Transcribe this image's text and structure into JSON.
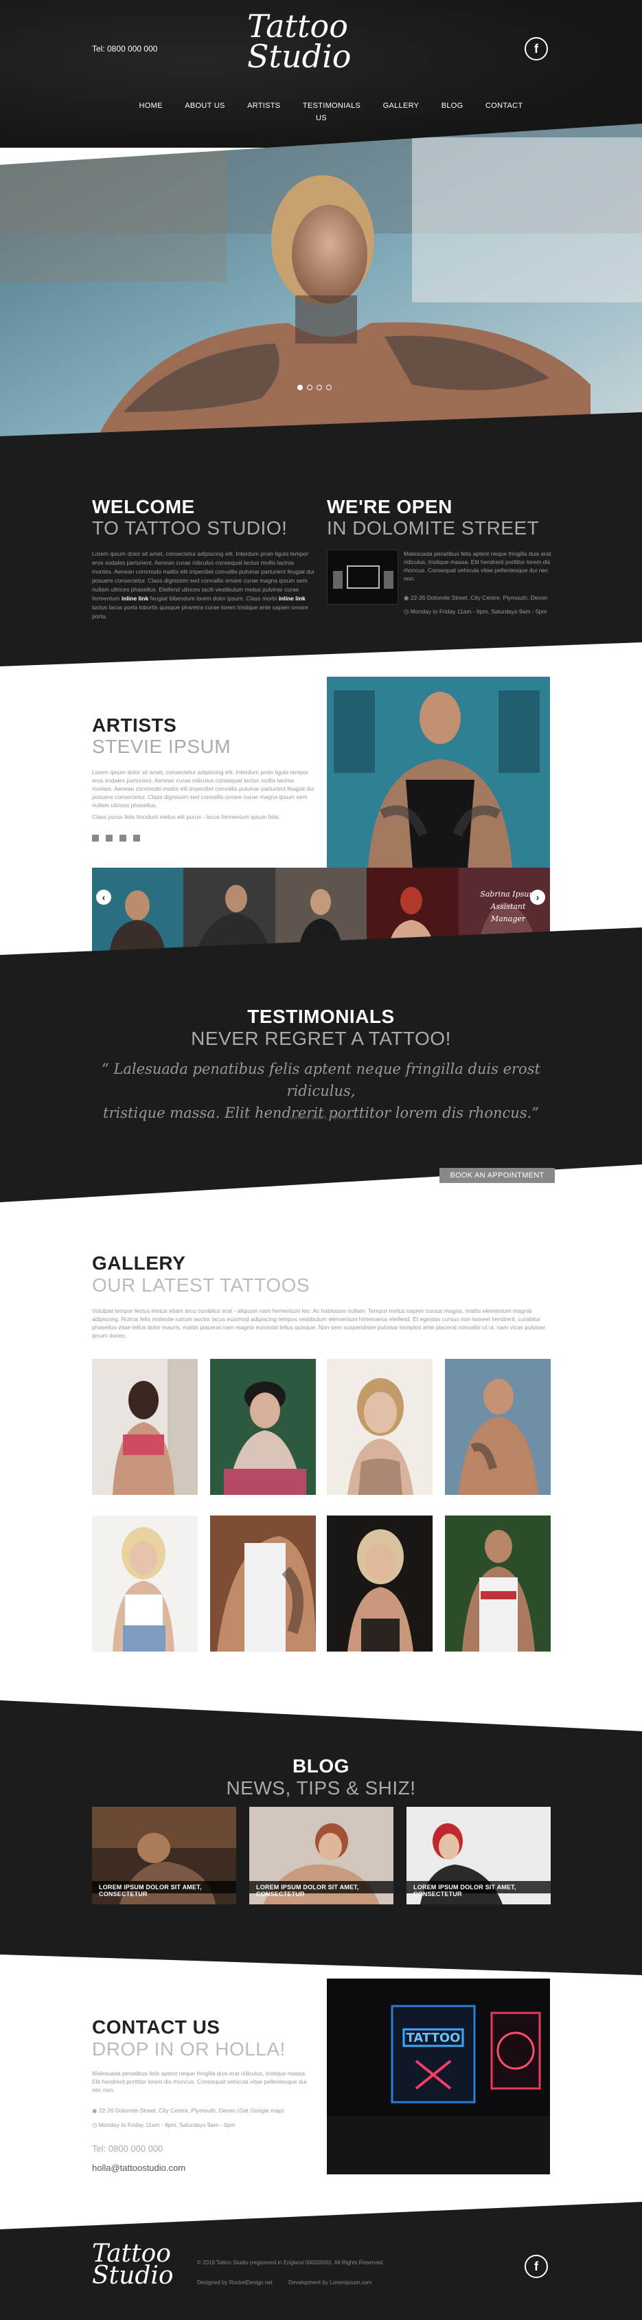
{
  "header": {
    "phone": "Tel: 0800 000 000",
    "logo_line1": "Tattoo",
    "logo_line2": "Studio",
    "social_icon": "facebook-icon",
    "nav": [
      "HOME",
      "ABOUT US",
      "ARTISTS",
      "TESTIMONIALS",
      "GALLERY",
      "BLOG",
      "CONTACT US"
    ]
  },
  "hero": {
    "slides": 4,
    "active_slide": 1
  },
  "welcome": {
    "title": "WELCOME",
    "subtitle": "TO TATTOO STUDIO!",
    "text": "Lorem ipsum dolor sit amet, consectetur adipiscing elit. Interdum proin ligula tempor eros sodales parturient. Aenean curae ridiculus consequat lectus mollis lacinia montes. Aenean commodo mattis elit imperdiet convallis pulvinar parturient feugiat dui posuere consectetur. Class dignissim sed convallis ornare curae magna ipsum sem nullam ultrices phasellus. Eleifend ultrices taciti vestibulum metus pulvinar curae fermentum",
    "link1": "inline link",
    "link_mid": "feugiat bibendum lorem dolor ipsum. Class morbi",
    "link2": "inline link",
    "text_end": "luctus lacus porta lobortis quisque pharetra curae lorem tristique ante sapien ornare porta."
  },
  "open": {
    "title": "WE'RE OPEN",
    "subtitle": "IN DOLOMITE STREET",
    "text": "Malesuada penatibus felis aptent neque fringilla duis erat ridiculus, tristique massa. Elit hendrerit porttitor lorem dis rhoncus. Consequat vehicula vitae pellentesque dui nec non.",
    "address": "22-26 Dolomite Street, City Centre, Plymouth, Devon",
    "hours": "Monday to Friday 11am - 6pm, Saturdays 9am - 5pm"
  },
  "artists": {
    "title": "ARTISTS",
    "subtitle": "STEVIE IPSUM",
    "text": "Lorem ipsum dolor sit amet, consectetur adipiscing elit. Interdum proin ligula tempor eros sodales parturient. Aenean curae ridiculus consequat lectus mollis lacinia montes. Aenean commodo mattis elit imperdiet convallis pulvinar parturient feugiat dui posuere consectetur. Class dignissim sed convallis ornare curae magna ipsum sem nullam ultrices phasellus.",
    "text2": "Class purus felis tincidunt metus elit purus - lacus fermentum ipsum felis.",
    "socials": [
      "facebook-icon",
      "twitter-icon",
      "linkedin-icon",
      "instagram-icon"
    ],
    "thumb_caption_line1": "Sabrina Ipsum",
    "thumb_caption_line2": "Assistant Manager"
  },
  "testimonials": {
    "title": "TESTIMONIALS",
    "subtitle": "NEVER REGRET A TATTOO!",
    "quote_line1": "“ Lalesuada penatibus felis aptent neque fringilla duis erost ridiculus,",
    "quote_line2": "tristique massa. Elit hendrerit porttitor lorem dis rhoncus.”",
    "author": "Lorraine Ipsum, Plymouth",
    "cta": "BOOK AN APPOINTMENT"
  },
  "gallery": {
    "title": "GALLERY",
    "subtitle": "OUR LATEST TATTOOS",
    "text": "Volutpat tempor lectus metus etiam arcu curabitur erat - aliquam nam fermentum leo. Ac habitasse nullam. Tempor metus sapien cursus magna, mattis elementum magnis adipiscing. Rutrus felis molestie rutrum auctor lacus euismod adipiscing tempus vestibulum elementum himenaeos eleifend. Et egestas cursus non laoreet hendrerit, curabitur phasellus vitae tellus dolor mauris, mattis placerat nam magnis euismod tellus quisque. Non sem suspendisse pulvinar inceptos ante placerat convallis ut ut, nam vicus pulvinar ipsum donec."
  },
  "blog": {
    "title": "BLOG",
    "subtitle": "NEWS, TIPS & SHIZ!",
    "cards": [
      "LOREM IPSUM DOLOR SIT AMET, CONSECTETUR",
      "LOREM IPSUM DOLOR SIT AMET, CONSECTETUR",
      "LOREM IPSUM DOLOR SIT AMET, CONSECTETUR"
    ]
  },
  "contact": {
    "title": "CONTACT US",
    "subtitle": "DROP IN OR HOLLA!",
    "text": "Malesuada penatibus felis aptent neque fringilla duis erat ridiculus, tristique massa. Elit hendrerit porttitor lorem dis rhoncus. Consequat vehicula vitae pellentesque dui nec non.",
    "address": "22-26 Dolomite Street, City Centre, Plymouth, Devon (Get Google map)",
    "hours": "Monday to Friday 11am - 6pm, Saturdays 9am - 5pm",
    "phone": "Tel: 0800 000 000",
    "email": "holla@tattoostudio.com"
  },
  "footer": {
    "logo_line1": "Tattoo",
    "logo_line2": "Studio",
    "copyright": "© 2019 Tattoo Studio (registered in England 00000000). All Rights Reserved.",
    "designed_by": "Designed by RocketDesign.net",
    "developed_by": "Development by Loremipsum.com"
  },
  "colors": {
    "dark": "#1c1c1c",
    "light_heading": "#aaaaaa",
    "white": "#ffffff",
    "button": "#888888"
  }
}
